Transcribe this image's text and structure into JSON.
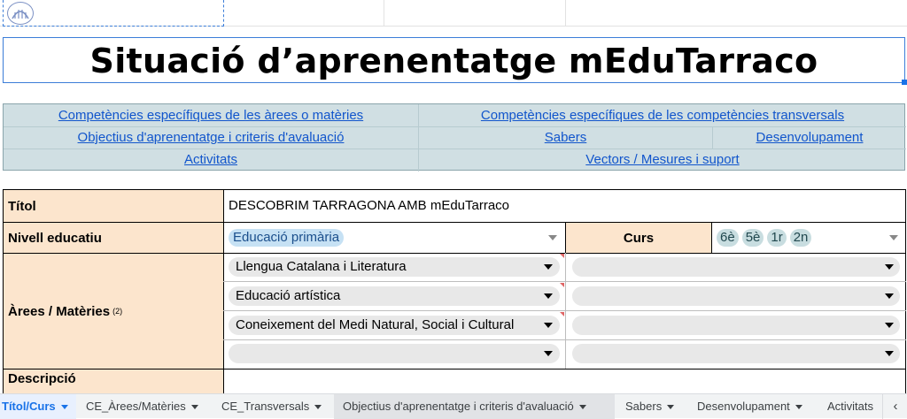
{
  "title": "Situació d’aprenentatge mEduTarraco",
  "links": {
    "row1": [
      "Competències específiques de les àrees o matèries",
      "Competències específiques de les competències transversals"
    ],
    "row2": [
      "Objectius d'aprenentatge i criteris d'avaluació",
      "Sabers",
      "Desenvolupament"
    ],
    "row3": [
      "Activitats",
      "Vectors / Mesures i suport"
    ]
  },
  "form": {
    "titol_label": "Títol",
    "titol_value": "DESCOBRIM TARRAGONA AMB mEduTarraco",
    "nivell_label": "Nivell educatiu",
    "nivell_value": "Educació primària",
    "curs_label": "Curs",
    "curs_values": [
      "6è",
      "5è",
      "1r",
      "2n"
    ],
    "arees_label": "Àrees / Matèries",
    "arees_note": "(2)",
    "arees_values": [
      "Llengua Catalana i Literatura",
      "Educació artística",
      "Coneixement del Medi Natural, Social i Cultural",
      ""
    ],
    "descripcio_label": "Descripció"
  },
  "tabs": [
    {
      "label": "Títol/Curs",
      "active": true
    },
    {
      "label": "CE_Àrees/Matèries"
    },
    {
      "label": "CE_Transversals"
    },
    {
      "label": "Objectius d'aprenentatge i criteris d'avaluació"
    },
    {
      "label": "Sabers"
    },
    {
      "label": "Desenvolupament"
    },
    {
      "label": "Activitats"
    }
  ],
  "colors": {
    "label_bg": "#fce5cd",
    "links_bg": "#d0dfe3",
    "link": "#1155cc",
    "active_tab": "#1a73e8"
  },
  "icons": [
    "logo-emblem",
    "dropdown-arrow-icon",
    "tab-caret-icon",
    "scroll-left-icon"
  ]
}
